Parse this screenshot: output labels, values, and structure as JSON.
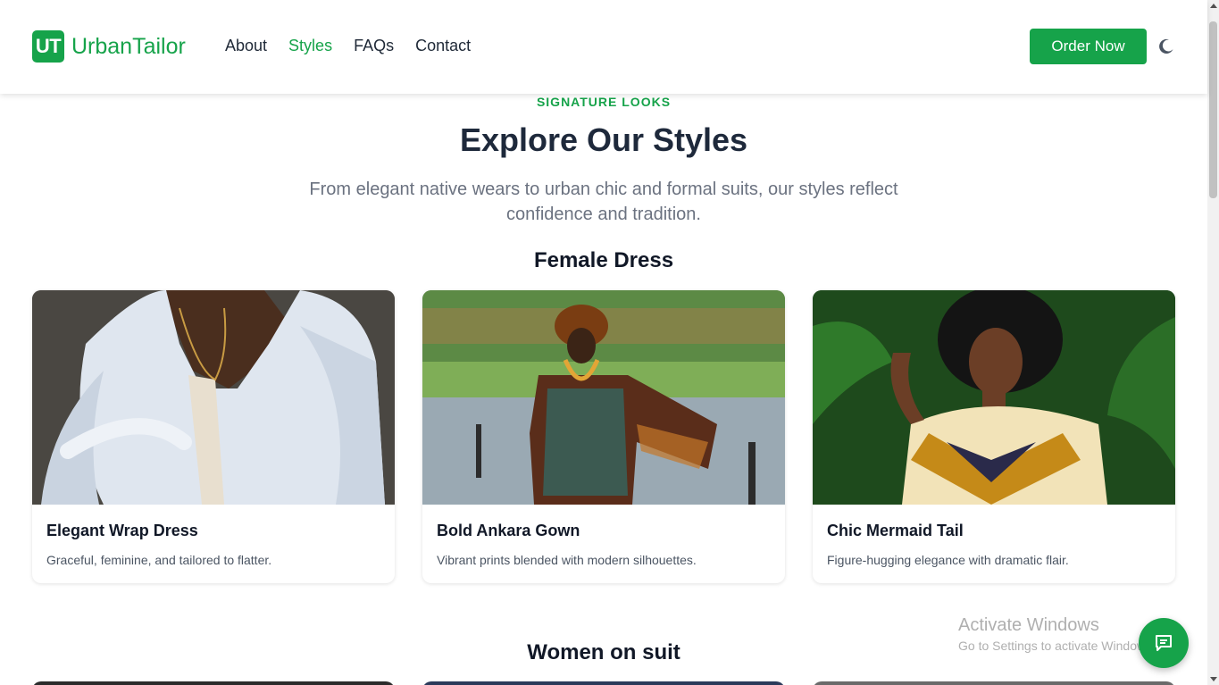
{
  "brand": {
    "badge": "UT",
    "name": "UrbanTailor",
    "accent": "#16a34a"
  },
  "nav": [
    {
      "label": "About",
      "active": false
    },
    {
      "label": "Styles",
      "active": true
    },
    {
      "label": "FAQs",
      "active": false
    },
    {
      "label": "Contact",
      "active": false
    }
  ],
  "header": {
    "cta_label": "Order Now",
    "theme_icon": "moon-icon"
  },
  "section": {
    "eyebrow": "SIGNATURE LOOKS",
    "title": "Explore Our Styles",
    "subtitle": "From elegant native wears to urban chic and formal suits, our styles reflect confidence and tradition."
  },
  "categories": [
    {
      "title": "Female Dress",
      "cards": [
        {
          "name": "Elegant Wrap Dress",
          "description": "Graceful, feminine, and tailored to flatter."
        },
        {
          "name": "Bold Ankara Gown",
          "description": "Vibrant prints blended with modern silhouettes."
        },
        {
          "name": "Chic Mermaid Tail",
          "description": "Figure-hugging elegance with dramatic flair."
        }
      ]
    },
    {
      "title": "Women on suit"
    }
  ],
  "watermark": {
    "line1": "Activate Windows",
    "line2": "Go to Settings to activate Windows."
  },
  "chat": {
    "icon": "chat-icon"
  }
}
